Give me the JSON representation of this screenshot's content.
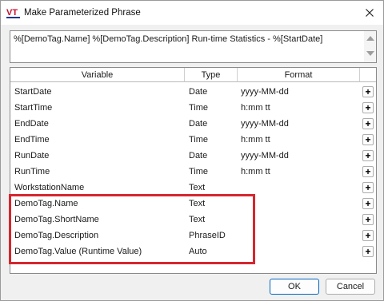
{
  "window": {
    "title": "Make Parameterized Phrase",
    "logo_text": "VT"
  },
  "phrase": {
    "value": "%[DemoTag.Name] %[DemoTag.Description] Run-time Statistics - %[StartDate]"
  },
  "grid": {
    "headers": {
      "variable": "Variable",
      "type": "Type",
      "format": "Format"
    },
    "add_label": "+",
    "rows": [
      {
        "variable": "StartDate",
        "type": "Date",
        "format": "yyyy-MM-dd"
      },
      {
        "variable": "StartTime",
        "type": "Time",
        "format": "h:mm tt"
      },
      {
        "variable": "EndDate",
        "type": "Date",
        "format": "yyyy-MM-dd"
      },
      {
        "variable": "EndTime",
        "type": "Time",
        "format": "h:mm tt"
      },
      {
        "variable": "RunDate",
        "type": "Date",
        "format": "yyyy-MM-dd"
      },
      {
        "variable": "RunTime",
        "type": "Time",
        "format": "h:mm tt"
      },
      {
        "variable": "WorkstationName",
        "type": "Text",
        "format": ""
      },
      {
        "variable": "DemoTag.Name",
        "type": "Text",
        "format": ""
      },
      {
        "variable": "DemoTag.ShortName",
        "type": "Text",
        "format": ""
      },
      {
        "variable": "DemoTag.Description",
        "type": "PhraseID",
        "format": ""
      },
      {
        "variable": "DemoTag.Value (Runtime Value)",
        "type": "Auto",
        "format": ""
      }
    ]
  },
  "buttons": {
    "ok": "OK",
    "cancel": "Cancel"
  },
  "colors": {
    "highlight": "#d7262e",
    "logo_red": "#c8102e",
    "logo_blue": "#1b3a8c"
  }
}
